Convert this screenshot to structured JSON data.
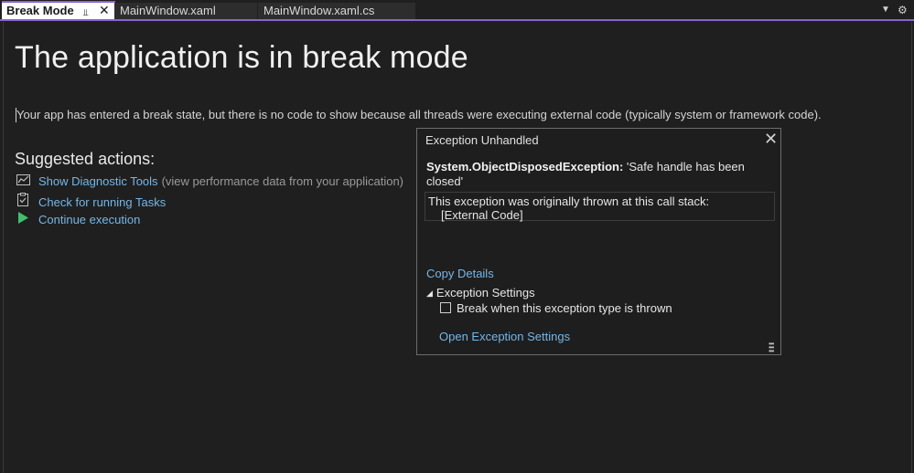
{
  "tabs": [
    {
      "label": "Break Mode",
      "active": true
    },
    {
      "label": "MainWindow.xaml",
      "active": false
    },
    {
      "label": "MainWindow.xaml.cs",
      "active": false
    }
  ],
  "icons": {
    "pin": "pin-icon",
    "close": "close-icon",
    "dropdown": "chevron-down-icon",
    "settings": "gear-icon"
  },
  "colors": {
    "accent": "#8a63d2",
    "link": "#75b6e7",
    "continue_icon": "#3fbf6f",
    "background": "#1f1f1f"
  },
  "main": {
    "title": "The application is in break mode",
    "info": "Your app has entered a break state, but there is no code to show because all threads were executing external code (typically system or framework code).",
    "suggested_heading": "Suggested actions:",
    "actions": [
      {
        "label": "Show Diagnostic Tools",
        "hint": "(view performance data from your application)",
        "icon": "chart-icon"
      },
      {
        "label": "Check for running Tasks",
        "hint": "",
        "icon": "clipboard-check-icon"
      },
      {
        "label": "Continue execution",
        "hint": "",
        "icon": "play-icon"
      }
    ]
  },
  "exception_popup": {
    "title": "Exception Unhandled",
    "exception_type": "System.ObjectDisposedException:",
    "exception_message": "'Safe handle has been closed'",
    "stack_intro": "This exception was originally thrown at this call stack:",
    "stack_frame": "[External Code]",
    "copy_details": "Copy Details",
    "settings_heading": "Exception Settings",
    "break_checkbox_label": "Break when this exception type is thrown",
    "break_checked": false,
    "open_settings": "Open Exception Settings"
  }
}
